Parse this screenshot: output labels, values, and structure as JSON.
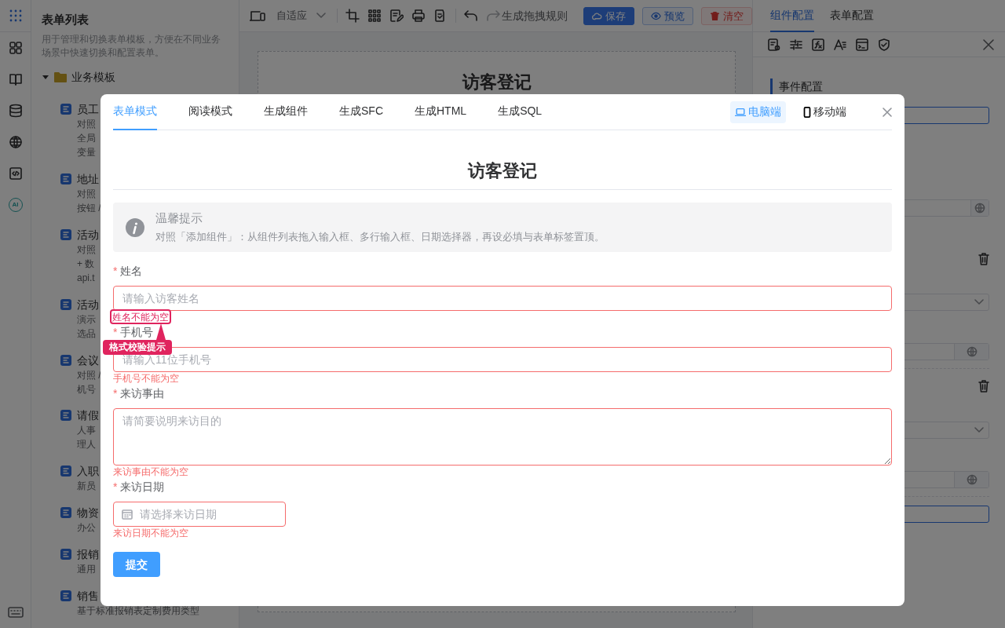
{
  "rail": {
    "ai_label": "AI"
  },
  "form_list": {
    "title": "表单列表",
    "description": "用于管理和切换表单模板，方便在不同业务场景中快速切换和配置表单。",
    "folder": {
      "label": "业务模板",
      "expanded": true,
      "children": [
        {
          "title": "员工",
          "lines": [
            "对照",
            "全局",
            "变量"
          ]
        },
        {
          "title": "地址",
          "lines": [
            "对照",
            "按钮 /"
          ]
        },
        {
          "title": "活动",
          "lines": [
            "对照",
            "+ 数",
            "api.t"
          ]
        },
        {
          "title": "活动",
          "lines": [
            "演示",
            "选品"
          ]
        },
        {
          "title": "会议",
          "lines": [
            "对照 /",
            "机号"
          ]
        },
        {
          "title": "请假",
          "lines": [
            "人事",
            "理人"
          ]
        },
        {
          "title": "入职",
          "lines": [
            "新员"
          ]
        },
        {
          "title": "物资",
          "lines": [
            "办公"
          ]
        },
        {
          "title": "报销",
          "lines": [
            "通用"
          ]
        },
        {
          "title": "销售",
          "lines": [
            "基于标准报销表定制费用类型"
          ]
        }
      ]
    }
  },
  "toolbar": {
    "scale": "自适应",
    "rule_label": "生成拖拽规则",
    "buttons": [
      {
        "label": "保存",
        "kind": "save"
      },
      {
        "label": "预览",
        "kind": "preview"
      },
      {
        "label": "清空",
        "kind": "clear"
      }
    ]
  },
  "canvas": {
    "title": "访客登记"
  },
  "config_panel": {
    "tabs": [
      {
        "label": "组件配置",
        "selected": true
      },
      {
        "label": "表单配置",
        "selected": false
      }
    ],
    "section": "事件配置"
  },
  "dialog": {
    "tabs": [
      {
        "label": "表单模式",
        "selected": true
      },
      {
        "label": "阅读模式",
        "selected": false
      },
      {
        "label": "生成组件",
        "selected": false
      },
      {
        "label": "生成SFC",
        "selected": false
      },
      {
        "label": "生成HTML",
        "selected": false
      },
      {
        "label": "生成SQL",
        "selected": false
      }
    ],
    "devices": [
      {
        "label": "电脑端",
        "kind": "desktop",
        "selected": true
      },
      {
        "label": "移动端",
        "kind": "mobile",
        "selected": false
      }
    ],
    "form": {
      "title": "访客登记",
      "notice": {
        "title": "温馨提示",
        "text": "对照「添加组件」：从组件列表拖入输入框、多行输入框、日期选择器，再设必填与表单标签置顶。"
      },
      "required_mark": "*",
      "fields": [
        {
          "kind": "text",
          "label": "姓名",
          "required": true,
          "placeholder": "请输入访客姓名",
          "error": "姓名不能为空",
          "error_highlighted": true
        },
        {
          "kind": "text",
          "label": "手机号",
          "required": true,
          "placeholder": "请输入11位手机号",
          "error": "手机号不能为空",
          "error_highlighted": false
        },
        {
          "kind": "textarea",
          "label": "来访事由",
          "required": true,
          "placeholder": "请简要说明来访目的",
          "error": "来访事由不能为空",
          "error_highlighted": false
        },
        {
          "kind": "date",
          "label": "来访日期",
          "required": true,
          "placeholder": "请选择来访日期",
          "error": "来访日期不能为空",
          "error_highlighted": false
        }
      ],
      "submit": "提交"
    },
    "annotation": {
      "label": "格式校验提示"
    }
  }
}
